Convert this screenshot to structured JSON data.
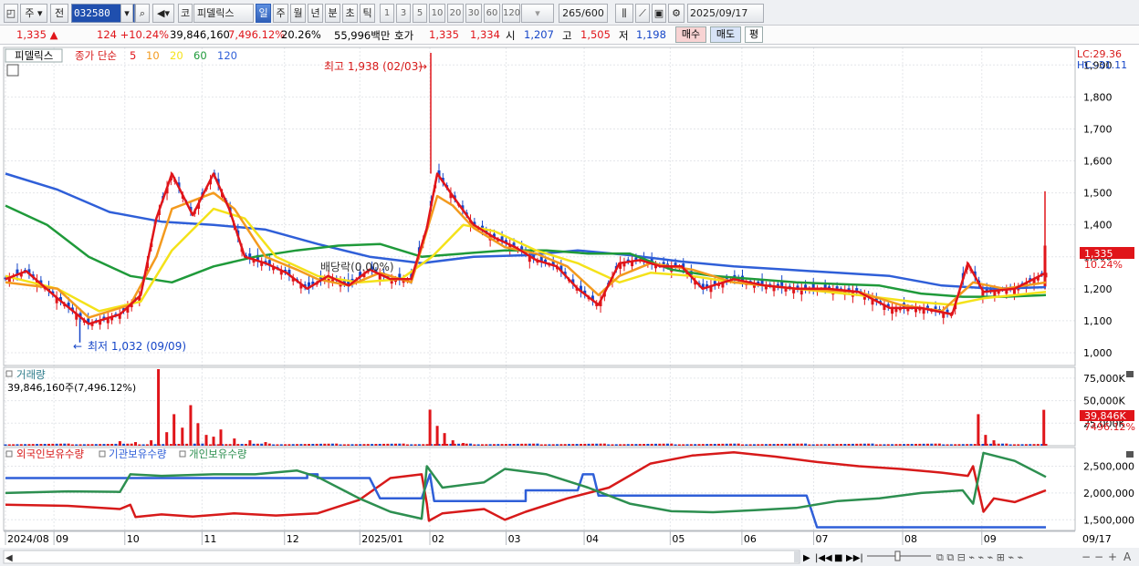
{
  "toolbar": {
    "market": "주",
    "prev": "전",
    "stock_code": "032580",
    "market_tab": "코",
    "stock_name": "피델릭스",
    "periods": [
      "일",
      "주",
      "월",
      "년",
      "분",
      "초",
      "틱"
    ],
    "intervals": [
      "1",
      "3",
      "5",
      "10",
      "20",
      "30",
      "60",
      "120"
    ],
    "count": "265",
    "count_max": "/600",
    "date": "2025/09/17",
    "active_period": "일"
  },
  "quote": {
    "price": "1,335",
    "change_arrow": "▲",
    "change": "124",
    "change_rate": "+10.24%",
    "volume": "39,846,160",
    "volume_rate": "7,496.12%",
    "turnover": "20.26%",
    "amount": "55,996백만",
    "ask_label": "호가",
    "ask": "1,335",
    "bid": "1,334",
    "open_label": "시",
    "open": "1,207",
    "high_label": "고",
    "high": "1,505",
    "low_label": "저",
    "low": "1,198",
    "buy_button": "매수",
    "sell_button": "매도",
    "avg_button": "평"
  },
  "price_panel": {
    "stock_label": "피델릭스",
    "legend_prefix": "종가 단순",
    "ma_labels": [
      {
        "label": "5",
        "color": "#e0151a"
      },
      {
        "label": "10",
        "color": "#f39a1e"
      },
      {
        "label": "20",
        "color": "#f4e21a"
      },
      {
        "label": "60",
        "color": "#1f9a3a"
      },
      {
        "label": "120",
        "color": "#2f5fd8"
      }
    ],
    "lc": "LC:29.36",
    "hc": "HC:-31.11",
    "high_annotation": "최고 1,938 (02/03)",
    "low_annotation": "최저 1,032 (09/09)",
    "dividend_annotation": "배당락(0.00%)",
    "current_price_tag": "1,335",
    "current_rate_tag": "10.24%"
  },
  "volume_panel": {
    "title": "거래량",
    "summary": "39,846,160주(7,496.12%)",
    "current_tag": "39,846K",
    "rate_tag": "7496.12%"
  },
  "holding_panel": {
    "foreign_label": "외국인보유수량",
    "institution_label": "기관보유수량",
    "individual_label": "개인보유수량"
  },
  "x_axis": {
    "labels": [
      {
        "label": "2024/08",
        "t": 0
      },
      {
        "label": "09",
        "t": 0.0466
      },
      {
        "label": "10",
        "t": 0.1147
      },
      {
        "label": "11",
        "t": 0.1889
      },
      {
        "label": "12",
        "t": 0.2682
      },
      {
        "label": "2025/01",
        "t": 0.3406
      },
      {
        "label": "02",
        "t": 0.4079
      },
      {
        "label": "03",
        "t": 0.4812
      },
      {
        "label": "04",
        "t": 0.5562
      },
      {
        "label": "05",
        "t": 0.6389
      },
      {
        "label": "06",
        "t": 0.7078
      },
      {
        "label": "07",
        "t": 0.7768
      },
      {
        "label": "08",
        "t": 0.8623
      },
      {
        "label": "09",
        "t": 0.9384
      }
    ],
    "last_label": "09/17"
  },
  "chart_data": [
    {
      "type": "candlestick",
      "title": "피델릭스 종가 단순 5 10 20 60 120",
      "y_ticks": [
        1000,
        1100,
        1200,
        1300,
        1400,
        1500,
        1600,
        1700,
        1800,
        1900
      ],
      "ylim": [
        960,
        1955
      ],
      "high": {
        "value": 1938,
        "date": "02/03"
      },
      "low": {
        "value": 1032,
        "date": "09/09"
      },
      "ma5_key_points": [
        [
          0,
          1230
        ],
        [
          0.02,
          1255
        ],
        [
          0.05,
          1170
        ],
        [
          0.08,
          1090
        ],
        [
          0.11,
          1120
        ],
        [
          0.13,
          1180
        ],
        [
          0.145,
          1420
        ],
        [
          0.16,
          1560
        ],
        [
          0.18,
          1430
        ],
        [
          0.2,
          1560
        ],
        [
          0.215,
          1450
        ],
        [
          0.23,
          1300
        ],
        [
          0.25,
          1280
        ],
        [
          0.27,
          1250
        ],
        [
          0.29,
          1200
        ],
        [
          0.31,
          1240
        ],
        [
          0.33,
          1210
        ],
        [
          0.35,
          1260
        ],
        [
          0.37,
          1230
        ],
        [
          0.39,
          1230
        ],
        [
          0.405,
          1390
        ],
        [
          0.415,
          1560
        ],
        [
          0.43,
          1490
        ],
        [
          0.45,
          1400
        ],
        [
          0.47,
          1360
        ],
        [
          0.49,
          1330
        ],
        [
          0.51,
          1290
        ],
        [
          0.53,
          1270
        ],
        [
          0.55,
          1200
        ],
        [
          0.57,
          1150
        ],
        [
          0.59,
          1280
        ],
        [
          0.61,
          1290
        ],
        [
          0.63,
          1270
        ],
        [
          0.65,
          1270
        ],
        [
          0.67,
          1200
        ],
        [
          0.7,
          1230
        ],
        [
          0.73,
          1210
        ],
        [
          0.76,
          1200
        ],
        [
          0.79,
          1200
        ],
        [
          0.82,
          1190
        ],
        [
          0.85,
          1140
        ],
        [
          0.88,
          1140
        ],
        [
          0.91,
          1120
        ],
        [
          0.925,
          1280
        ],
        [
          0.94,
          1190
        ],
        [
          0.97,
          1200
        ],
        [
          1,
          1250
        ]
      ],
      "ma10_key_points": [
        [
          0,
          1220
        ],
        [
          0.05,
          1200
        ],
        [
          0.08,
          1110
        ],
        [
          0.12,
          1150
        ],
        [
          0.145,
          1300
        ],
        [
          0.16,
          1450
        ],
        [
          0.2,
          1500
        ],
        [
          0.22,
          1450
        ],
        [
          0.25,
          1300
        ],
        [
          0.28,
          1260
        ],
        [
          0.3,
          1230
        ],
        [
          0.33,
          1210
        ],
        [
          0.36,
          1250
        ],
        [
          0.39,
          1220
        ],
        [
          0.415,
          1490
        ],
        [
          0.43,
          1460
        ],
        [
          0.45,
          1390
        ],
        [
          0.48,
          1330
        ],
        [
          0.51,
          1310
        ],
        [
          0.54,
          1270
        ],
        [
          0.57,
          1180
        ],
        [
          0.59,
          1240
        ],
        [
          0.62,
          1280
        ],
        [
          0.66,
          1260
        ],
        [
          0.7,
          1220
        ],
        [
          0.76,
          1200
        ],
        [
          0.82,
          1190
        ],
        [
          0.86,
          1150
        ],
        [
          0.9,
          1130
        ],
        [
          0.93,
          1220
        ],
        [
          0.96,
          1200
        ],
        [
          1,
          1220
        ]
      ],
      "ma20_key_points": [
        [
          0,
          1240
        ],
        [
          0.05,
          1200
        ],
        [
          0.09,
          1130
        ],
        [
          0.13,
          1160
        ],
        [
          0.16,
          1320
        ],
        [
          0.2,
          1450
        ],
        [
          0.23,
          1420
        ],
        [
          0.26,
          1300
        ],
        [
          0.3,
          1240
        ],
        [
          0.34,
          1220
        ],
        [
          0.38,
          1230
        ],
        [
          0.41,
          1300
        ],
        [
          0.44,
          1400
        ],
        [
          0.47,
          1380
        ],
        [
          0.51,
          1320
        ],
        [
          0.55,
          1280
        ],
        [
          0.59,
          1220
        ],
        [
          0.62,
          1250
        ],
        [
          0.66,
          1240
        ],
        [
          0.7,
          1220
        ],
        [
          0.76,
          1200
        ],
        [
          0.82,
          1180
        ],
        [
          0.87,
          1160
        ],
        [
          0.91,
          1150
        ],
        [
          0.94,
          1170
        ],
        [
          1,
          1190
        ]
      ],
      "ma60_key_points": [
        [
          0,
          1460
        ],
        [
          0.04,
          1400
        ],
        [
          0.08,
          1300
        ],
        [
          0.12,
          1240
        ],
        [
          0.16,
          1220
        ],
        [
          0.2,
          1270
        ],
        [
          0.24,
          1300
        ],
        [
          0.28,
          1320
        ],
        [
          0.32,
          1335
        ],
        [
          0.36,
          1340
        ],
        [
          0.4,
          1300
        ],
        [
          0.44,
          1310
        ],
        [
          0.48,
          1320
        ],
        [
          0.52,
          1320
        ],
        [
          0.56,
          1310
        ],
        [
          0.6,
          1310
        ],
        [
          0.64,
          1260
        ],
        [
          0.68,
          1240
        ],
        [
          0.72,
          1230
        ],
        [
          0.76,
          1220
        ],
        [
          0.8,
          1215
        ],
        [
          0.84,
          1210
        ],
        [
          0.88,
          1185
        ],
        [
          0.92,
          1175
        ],
        [
          0.96,
          1175
        ],
        [
          1,
          1180
        ]
      ],
      "ma120_key_points": [
        [
          0,
          1560
        ],
        [
          0.05,
          1510
        ],
        [
          0.1,
          1440
        ],
        [
          0.15,
          1410
        ],
        [
          0.2,
          1400
        ],
        [
          0.25,
          1385
        ],
        [
          0.3,
          1340
        ],
        [
          0.35,
          1300
        ],
        [
          0.4,
          1280
        ],
        [
          0.45,
          1300
        ],
        [
          0.5,
          1305
        ],
        [
          0.55,
          1320
        ],
        [
          0.6,
          1305
        ],
        [
          0.65,
          1285
        ],
        [
          0.7,
          1270
        ],
        [
          0.75,
          1260
        ],
        [
          0.8,
          1250
        ],
        [
          0.85,
          1240
        ],
        [
          0.9,
          1210
        ],
        [
          0.95,
          1200
        ],
        [
          1,
          1205
        ]
      ],
      "ma5_color": "#e0151a",
      "ma10_color": "#f39a1e",
      "ma20_color": "#f4e21a",
      "ma60_color": "#1f9a3a",
      "ma120_color": "#2f5fd8",
      "up_color": "#e0151a",
      "down_color": "#1646c8"
    },
    {
      "type": "bar",
      "title": "거래량",
      "y_ticks": [
        {
          "value": 25000,
          "label": "25,000K"
        },
        {
          "value": 50000,
          "label": "50,000K"
        },
        {
          "value": 75000,
          "label": "75,000K"
        }
      ],
      "ylim": [
        0,
        85000
      ],
      "spikes_k": [
        [
          0.11,
          5000
        ],
        [
          0.125,
          4000
        ],
        [
          0.14,
          6000
        ],
        [
          0.147,
          85000
        ],
        [
          0.155,
          15000
        ],
        [
          0.162,
          35000
        ],
        [
          0.17,
          20000
        ],
        [
          0.178,
          45000
        ],
        [
          0.185,
          25000
        ],
        [
          0.193,
          12000
        ],
        [
          0.2,
          10000
        ],
        [
          0.207,
          18000
        ],
        [
          0.22,
          8000
        ],
        [
          0.235,
          6000
        ],
        [
          0.25,
          4000
        ],
        [
          0.408,
          40000
        ],
        [
          0.415,
          22000
        ],
        [
          0.422,
          14000
        ],
        [
          0.43,
          6000
        ],
        [
          0.44,
          3000
        ],
        [
          0.935,
          35000
        ],
        [
          0.942,
          12000
        ],
        [
          0.95,
          6000
        ],
        [
          0.998,
          39846
        ]
      ],
      "current_k": 39846,
      "base_k": 1500
    },
    {
      "type": "line",
      "title": "외국인보유수량 기관보유수량 개인보유수량",
      "y_ticks": [
        1500000,
        2000000,
        2500000
      ],
      "ylim": [
        1300000,
        2850000
      ],
      "series": [
        {
          "name": "외국인보유수량",
          "color": "#d71a1a",
          "points": [
            [
              0,
              1780000
            ],
            [
              0.06,
              1760000
            ],
            [
              0.11,
              1700000
            ],
            [
              0.12,
              1780000
            ],
            [
              0.125,
              1550000
            ],
            [
              0.15,
              1600000
            ],
            [
              0.18,
              1560000
            ],
            [
              0.22,
              1620000
            ],
            [
              0.26,
              1580000
            ],
            [
              0.3,
              1620000
            ],
            [
              0.34,
              1870000
            ],
            [
              0.37,
              2280000
            ],
            [
              0.4,
              2350000
            ],
            [
              0.405,
              1800000
            ],
            [
              0.407,
              1480000
            ],
            [
              0.42,
              1620000
            ],
            [
              0.46,
              1700000
            ],
            [
              0.48,
              1500000
            ],
            [
              0.5,
              1650000
            ],
            [
              0.54,
              1900000
            ],
            [
              0.58,
              2100000
            ],
            [
              0.62,
              2550000
            ],
            [
              0.66,
              2700000
            ],
            [
              0.7,
              2760000
            ],
            [
              0.74,
              2680000
            ],
            [
              0.78,
              2580000
            ],
            [
              0.82,
              2500000
            ],
            [
              0.86,
              2450000
            ],
            [
              0.9,
              2380000
            ],
            [
              0.925,
              2320000
            ],
            [
              0.93,
              2500000
            ],
            [
              0.94,
              1650000
            ],
            [
              0.95,
              1900000
            ],
            [
              0.97,
              1830000
            ],
            [
              1,
              2050000
            ]
          ]
        },
        {
          "name": "기관보유수량",
          "color": "#2f5fd8",
          "points": [
            [
              0,
              2280000
            ],
            [
              0.29,
              2280000
            ],
            [
              0.29,
              2350000
            ],
            [
              0.3,
              2350000
            ],
            [
              0.3,
              2280000
            ],
            [
              0.35,
              2280000
            ],
            [
              0.36,
              1900000
            ],
            [
              0.4,
              1900000
            ],
            [
              0.408,
              2350000
            ],
            [
              0.412,
              1850000
            ],
            [
              0.45,
              1850000
            ],
            [
              0.5,
              1850000
            ],
            [
              0.5,
              2050000
            ],
            [
              0.55,
              2050000
            ],
            [
              0.555,
              2350000
            ],
            [
              0.565,
              2350000
            ],
            [
              0.57,
              1950000
            ],
            [
              0.77,
              1950000
            ],
            [
              0.78,
              1360000
            ],
            [
              1,
              1360000
            ]
          ]
        },
        {
          "name": "개인보유수량",
          "color": "#2d8f50",
          "points": [
            [
              0,
              2000000
            ],
            [
              0.06,
              2030000
            ],
            [
              0.11,
              2020000
            ],
            [
              0.12,
              2350000
            ],
            [
              0.15,
              2320000
            ],
            [
              0.2,
              2350000
            ],
            [
              0.24,
              2350000
            ],
            [
              0.28,
              2420000
            ],
            [
              0.3,
              2300000
            ],
            [
              0.34,
              1900000
            ],
            [
              0.37,
              1650000
            ],
            [
              0.4,
              1520000
            ],
            [
              0.405,
              2500000
            ],
            [
              0.42,
              2100000
            ],
            [
              0.46,
              2200000
            ],
            [
              0.48,
              2450000
            ],
            [
              0.52,
              2350000
            ],
            [
              0.56,
              2100000
            ],
            [
              0.6,
              1800000
            ],
            [
              0.64,
              1660000
            ],
            [
              0.68,
              1640000
            ],
            [
              0.72,
              1680000
            ],
            [
              0.76,
              1720000
            ],
            [
              0.8,
              1850000
            ],
            [
              0.84,
              1900000
            ],
            [
              0.88,
              2000000
            ],
            [
              0.92,
              2050000
            ],
            [
              0.93,
              1800000
            ],
            [
              0.94,
              2750000
            ],
            [
              0.97,
              2600000
            ],
            [
              1,
              2300000
            ]
          ]
        }
      ]
    }
  ]
}
